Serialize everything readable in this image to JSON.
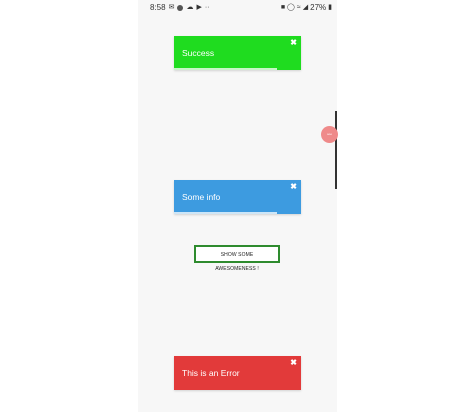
{
  "status_bar": {
    "time": "8:58",
    "left_icons": [
      "mail-icon",
      "messenger-icon",
      "cloud-icon",
      "youtube-icon"
    ],
    "more": "··",
    "battery": "27%",
    "right_icons": [
      "lock-icon",
      "alarm-icon",
      "wifi-icon",
      "signal-icon"
    ]
  },
  "toasts": {
    "success": {
      "text": "Success",
      "close": "✖",
      "color": "#1fdc1f",
      "progress": 0.81
    },
    "info": {
      "text": "Some info",
      "close": "✖",
      "color": "#3d9be0",
      "progress": 0.81
    },
    "error": {
      "text": "This is an Error",
      "close": "✖",
      "color": "#e23a3a",
      "progress": 0.0
    }
  },
  "main_button": {
    "label": "SHOW SOME AWESOMENESS !"
  },
  "side_bubble": {
    "label": "ooo"
  }
}
